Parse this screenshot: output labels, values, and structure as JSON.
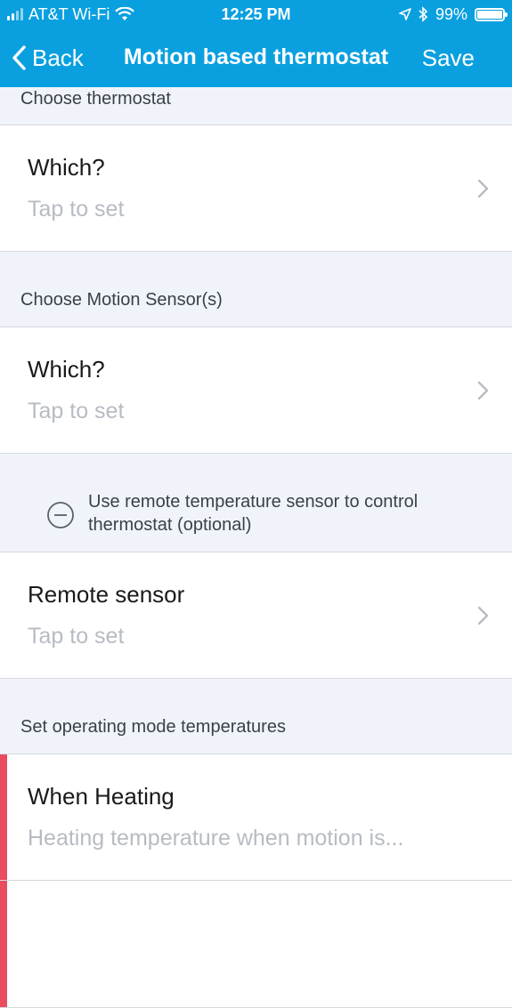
{
  "status": {
    "carrier": "AT&T Wi-Fi",
    "time": "12:25 PM",
    "battery": "99%",
    "battery_level": 0.99
  },
  "nav": {
    "back_label": "Back",
    "title": "Motion based thermostat",
    "save_label": "Save"
  },
  "sections": {
    "thermostat": {
      "header": "Choose thermostat",
      "row_title": "Which?",
      "row_value": "Tap to set"
    },
    "motion": {
      "header": "Choose Motion Sensor(s)",
      "row_title": "Which?",
      "row_value": "Tap to set"
    },
    "remote": {
      "toggle_text": "Use remote temperature sensor to control thermostat (optional)",
      "row_title": "Remote sensor",
      "row_value": "Tap to set"
    },
    "modes": {
      "header": "Set operating mode temperatures",
      "row_title": "When Heating",
      "row_value": "Heating temperature when motion is...",
      "accent_color": "#e94b5f"
    }
  },
  "colors": {
    "brand": "#0aa0e0",
    "background": "#f0f4fa"
  },
  "icons": [
    "wifi-icon",
    "location-arrow-icon",
    "bluetooth-icon",
    "battery-icon",
    "chevron-left-icon",
    "chevron-right-icon",
    "minus-circle-icon"
  ]
}
